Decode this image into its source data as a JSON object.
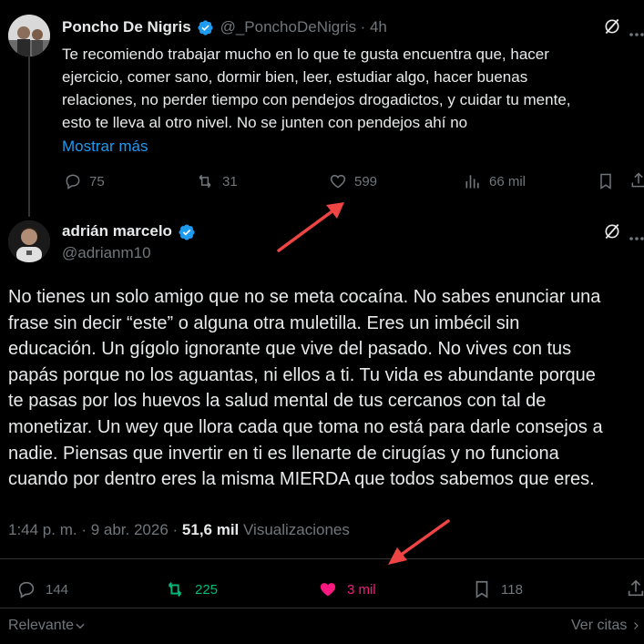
{
  "reply_tweet": {
    "name": "Poncho De Nigris",
    "handle": "@_PonchoDeNigris",
    "time": "· 4h",
    "text_lines": [
      "Te recomiendo trabajar mucho en lo que te gusta encuentra que, hacer",
      "ejercicio, comer sano, dormir bien, leer, estudiar algo, hacer buenas",
      "relaciones, no perder tiempo con pendejos drogadictos, y cuidar tu mente,",
      "esto te lleva al otro nivel. No se junten con pendejos ahí no"
    ],
    "show_more": "Mostrar más",
    "replies": "75",
    "retweets": "31",
    "likes": "599",
    "views": "66 mil"
  },
  "main_tweet": {
    "name": "adrián marcelo",
    "handle": "@adrianm10",
    "text_lines": [
      "No tienes un solo amigo que no se meta cocaína. No sabes enunciar una",
      "frase sin decir “este” o alguna otra muletilla. Eres un imbécil sin",
      "educación. Un gígolo ignorante que vive del pasado. No vives con tus",
      "papás porque no los aguantas, ni ellos a ti. Tu vida es abundante porque",
      "te pasas por los huevos la salud mental de tus cercanos con tal de",
      "monetizar. Un wey que llora cada que toma no está para darle consejos a",
      "nadie. Piensas que invertir en ti es llenarte de cirugías y no funciona",
      "cuando por dentro eres la misma MIERDA que todos sabemos que eres."
    ],
    "timestamp": "1:44 p. m. · 9 abr. 2026 ·",
    "views_count": "51,6 mil",
    "views_label": "Visualizaciones",
    "replies": "144",
    "retweets": "225",
    "likes": "3 mil",
    "bookmarks": "118"
  },
  "footer": {
    "sort_label": "Relevante",
    "quotes_label": "Ver citas"
  },
  "colors": {
    "background": "#000000",
    "text": "#e7e9ea",
    "muted": "#71767b",
    "link": "#1d9bf0",
    "retweet_active": "#00ba7c",
    "like_active": "#f91880",
    "annotation_arrow": "#ef4444"
  },
  "icons": [
    "verified-badge-icon",
    "grok-icon",
    "more-icon",
    "reply-icon",
    "retweet-icon",
    "like-icon",
    "views-icon",
    "bookmark-icon",
    "share-icon",
    "chevron-down-icon",
    "chevron-right-icon"
  ]
}
